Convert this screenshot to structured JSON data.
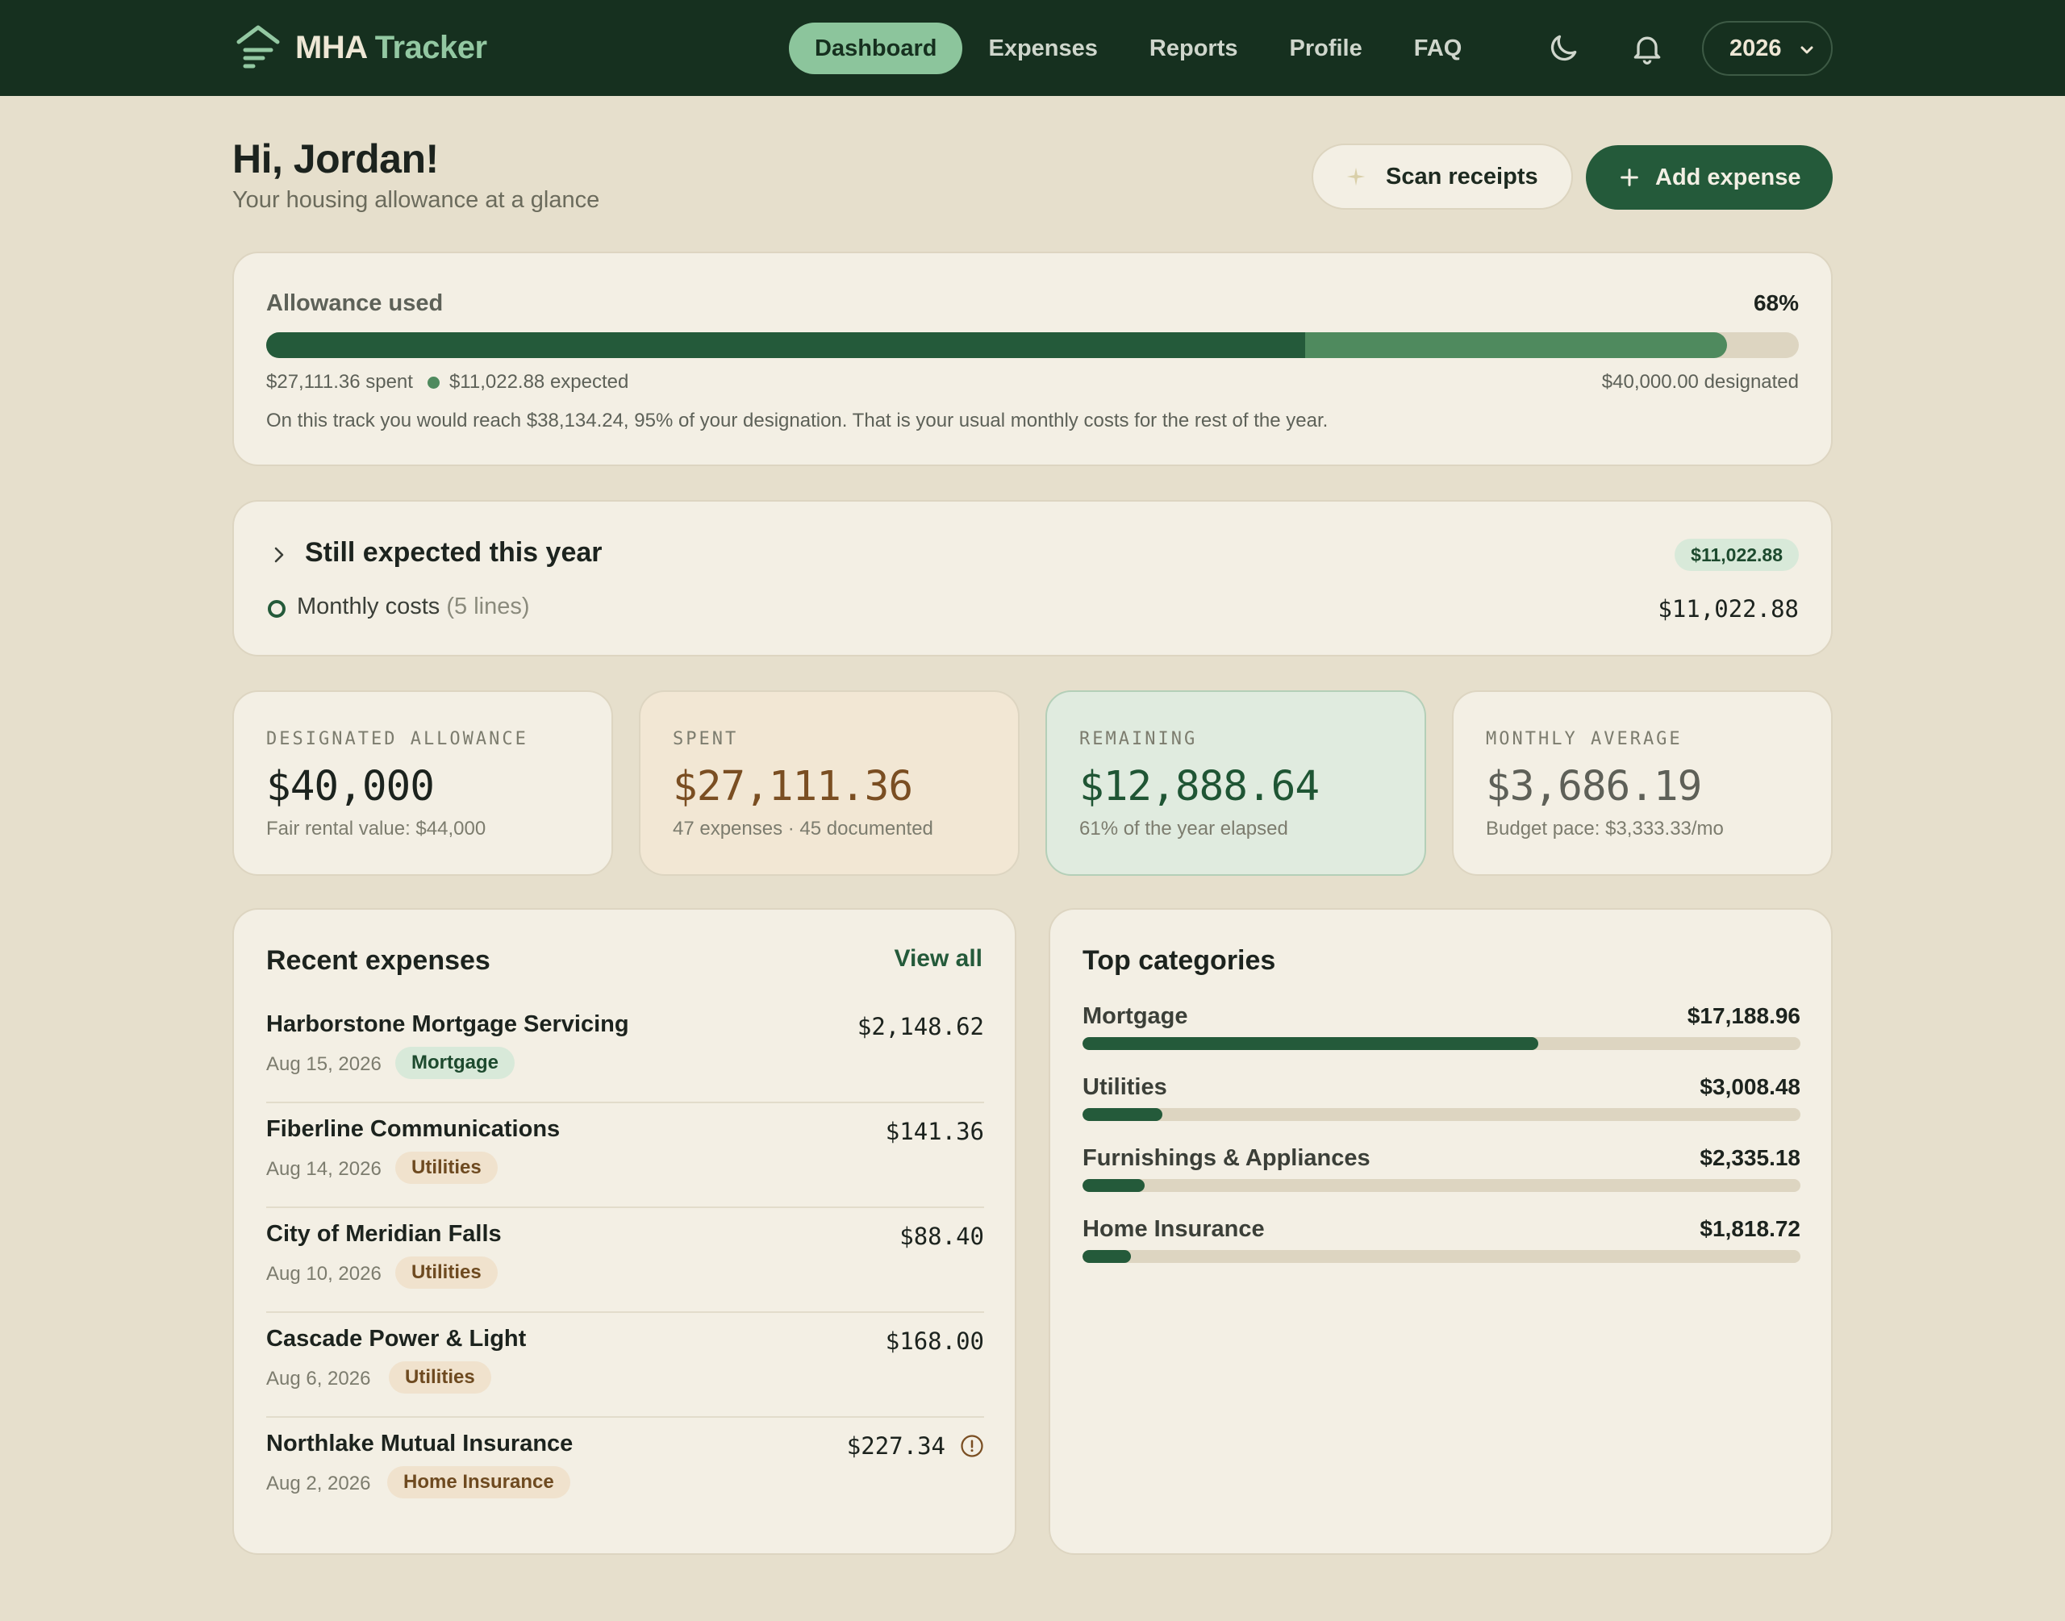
{
  "brand": {
    "name_part1": "MHA",
    "name_part2": "Tracker"
  },
  "nav": {
    "items": [
      {
        "label": "Dashboard",
        "active": true
      },
      {
        "label": "Expenses"
      },
      {
        "label": "Reports"
      },
      {
        "label": "Profile"
      },
      {
        "label": "FAQ"
      }
    ],
    "icons": [
      "moon-icon",
      "bell-icon"
    ],
    "year": "2026"
  },
  "header": {
    "greeting": "Hi, Jordan!",
    "subtitle": "Your housing allowance at a glance",
    "scan_label": "Scan receipts",
    "add_label": "Add expense"
  },
  "allowance": {
    "title": "Allowance used",
    "percent": "68%",
    "spent_fraction": 0.678,
    "expected_fraction": 0.275,
    "spent_text": "$27,111.36 spent",
    "expected_text": "$11,022.88 expected",
    "designated_text": "$40,000.00 designated",
    "note": "On this track you would reach $38,134.24, 95% of your designation. That is your usual monthly costs for the rest of the year."
  },
  "expected": {
    "title": "Still expected this year",
    "badge": "$11,022.88",
    "line_label": "Monthly costs",
    "line_count": "(5 lines)",
    "line_amount": "$11,022.88"
  },
  "stats": [
    {
      "label": "DESIGNATED ALLOWANCE",
      "value": "$40,000",
      "sub": "Fair rental value: $44,000"
    },
    {
      "label": "SPENT",
      "value": "$27,111.36",
      "sub": "47 expenses · 45 documented"
    },
    {
      "label": "REMAINING",
      "value": "$12,888.64",
      "sub": "61% of the year elapsed"
    },
    {
      "label": "MONTHLY AVERAGE",
      "value": "$3,686.19",
      "sub": "Budget pace: $3,333.33/mo"
    }
  ],
  "recent": {
    "title": "Recent expenses",
    "view_all": "View all",
    "items": [
      {
        "name": "Harborstone Mortgage Servicing",
        "date": "Aug 15, 2026",
        "category": "Mortgage",
        "amount": "$2,148.62"
      },
      {
        "name": "Fiberline Communications",
        "date": "Aug 14, 2026",
        "category": "Utilities",
        "amount": "$141.36"
      },
      {
        "name": "City of Meridian Falls",
        "date": "Aug 10, 2026",
        "category": "Utilities",
        "amount": "$88.40"
      },
      {
        "name": "Cascade Power & Light",
        "date": "Aug 6, 2026",
        "category": "Utilities",
        "amount": "$168.00"
      },
      {
        "name": "Northlake Mutual Insurance",
        "date": "Aug 2, 2026",
        "category": "Home Insurance",
        "amount": "$227.34",
        "warning": true
      }
    ]
  },
  "categories": {
    "title": "Top categories",
    "items": [
      {
        "name": "Mortgage",
        "amount": "$17,188.96",
        "fraction": 0.635
      },
      {
        "name": "Utilities",
        "amount": "$3,008.48",
        "fraction": 0.111
      },
      {
        "name": "Furnishings & Appliances",
        "amount": "$2,335.18",
        "fraction": 0.086
      },
      {
        "name": "Home Insurance",
        "amount": "$1,818.72",
        "fraction": 0.067
      }
    ]
  },
  "colors": {
    "nav_bg": "#16301f",
    "accent": "#245a3a",
    "accent_light": "#8cc59c",
    "background": "#e6dfcc",
    "card": "#f3efe4"
  }
}
